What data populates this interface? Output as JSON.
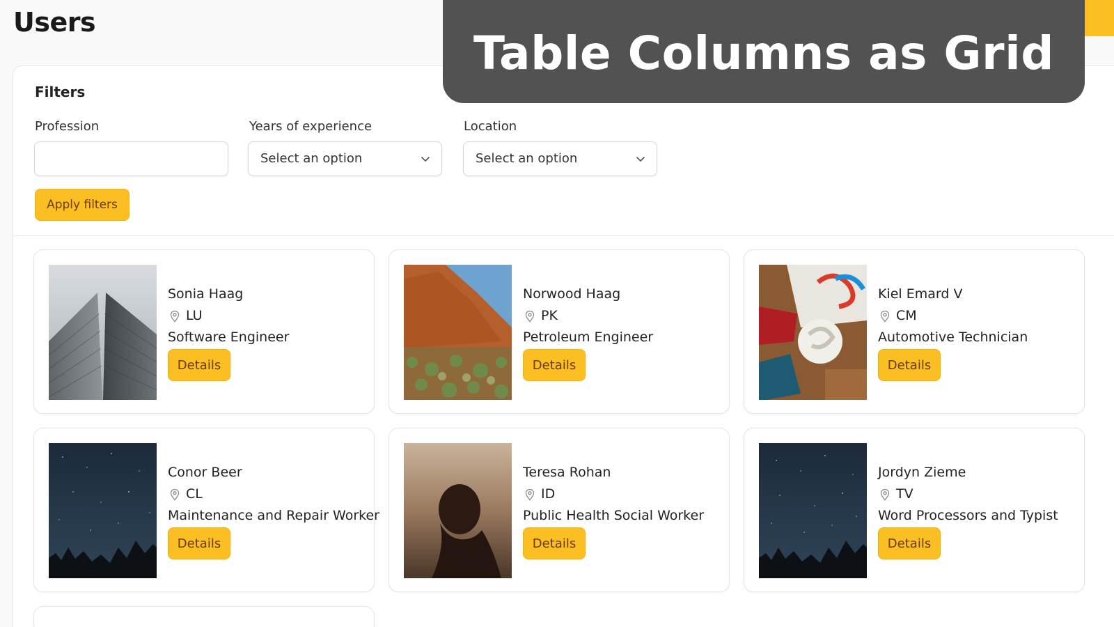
{
  "page": {
    "title": "Users"
  },
  "overlay": {
    "title": "Table Columns as Grid"
  },
  "filters": {
    "heading": "Filters",
    "profession": {
      "label": "Profession",
      "value": ""
    },
    "experience": {
      "label": "Years of experience",
      "value": "Select an option"
    },
    "location": {
      "label": "Location",
      "value": "Select an option"
    },
    "apply_label": "Apply filters"
  },
  "users": [
    {
      "name": "Sonia Haag",
      "location": "LU",
      "profession": "Software Engineer",
      "details_label": "Details",
      "image": "building-photo"
    },
    {
      "name": "Norwood Haag",
      "location": "PK",
      "profession": "Petroleum Engineer",
      "details_label": "Details",
      "image": "red-rock-desert-photo"
    },
    {
      "name": "Kiel Emard V",
      "location": "CM",
      "profession": "Automotive Technician",
      "details_label": "Details",
      "image": "design-items-photo"
    },
    {
      "name": "Conor Beer",
      "location": "CL",
      "profession": "Maintenance and Repair Worker",
      "details_label": "Details",
      "image": "night-sky-photo"
    },
    {
      "name": "Teresa Rohan",
      "location": "ID",
      "profession": "Public Health Social Worker",
      "details_label": "Details",
      "image": "woman-silhouette-photo"
    },
    {
      "name": "Jordyn Zieme",
      "location": "TV",
      "profession": "Word Processors and Typist",
      "details_label": "Details",
      "image": "night-sky-photo"
    }
  ],
  "colors": {
    "accent": "#fbbf24",
    "accent_text": "#6b3a00",
    "overlay": "#525252"
  },
  "icons": {
    "location": "map-pin-icon",
    "dropdown": "chevron-down-icon"
  }
}
